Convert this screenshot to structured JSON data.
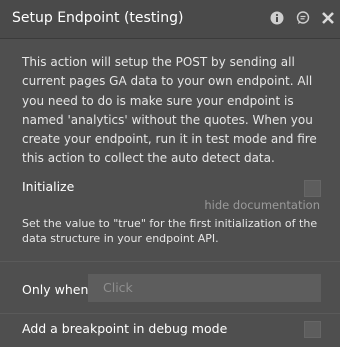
{
  "header": {
    "title": "Setup Endpoint (testing)",
    "icons": [
      "info-icon",
      "comment-icon",
      "close-icon"
    ]
  },
  "description": "This action will setup the POST by sending all current pages GA data to your own endpoint. All you need to do is make sure your endpoint is named 'analytics' without the quotes. When you create your endpoint, run it in test mode and fire this action to collect the auto detect data.",
  "fields": {
    "initialize_label": "Initialize",
    "hide_documentation": "hide documentation",
    "initialize_note": "Set the value to \"true\" for the first initialization of the data structure in your endpoint API.",
    "only_when_label": "Only when",
    "only_when_placeholder": "Click",
    "breakpoint_label": "Add a breakpoint in debug mode"
  },
  "colors": {
    "panel": "#4f4f4f",
    "titlebar": "#4a4a4a",
    "input": "#5d5d5d"
  }
}
